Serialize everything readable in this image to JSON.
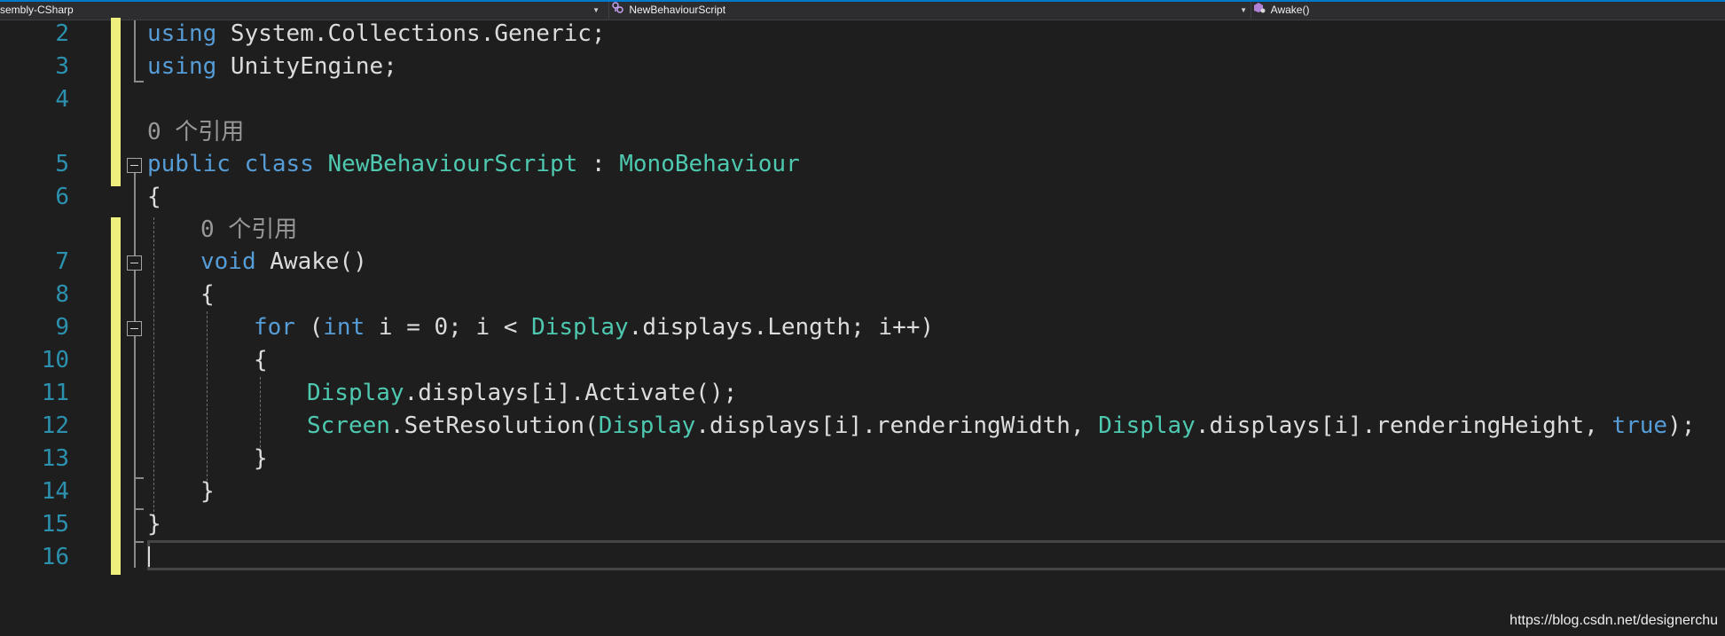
{
  "navbar": {
    "project": "sembly-CSharp",
    "type": "NewBehaviourScript",
    "member": "Awake()",
    "colors": {
      "background": "#2d2d30",
      "accent": "#007acc"
    }
  },
  "editor": {
    "line_numbers": [
      "2",
      "3",
      "4",
      "5",
      "6",
      "7",
      "8",
      "9",
      "10",
      "11",
      "12",
      "13",
      "14",
      "15",
      "16"
    ],
    "codelens_references": [
      "0 个引用",
      "0 个引用"
    ],
    "lines": {
      "l2": [
        "using",
        " System.Collections.Generic;"
      ],
      "l3": [
        "using",
        " UnityEngine;"
      ],
      "l5": [
        "public",
        " ",
        "class",
        " ",
        "NewBehaviourScript",
        " : ",
        "MonoBehaviour"
      ],
      "l6": [
        "{"
      ],
      "l7": [
        "void",
        " Awake()"
      ],
      "l8": [
        "{"
      ],
      "l9": [
        "for",
        " (",
        "int",
        " i = 0; i < ",
        "Display",
        ".displays.Length; i++)"
      ],
      "l10": [
        "{"
      ],
      "l11": [
        "Display",
        ".displays[i].Activate();"
      ],
      "l12": [
        "Screen",
        ".SetResolution(",
        "Display",
        ".displays[i].renderingWidth, ",
        "Display",
        ".displays[i].renderingHeight, ",
        "true",
        ");"
      ],
      "l13": [
        "}"
      ],
      "l14": [
        "}"
      ],
      "l15": [
        "}"
      ]
    },
    "colors": {
      "background": "#1e1e1e",
      "keyword": "#569cd6",
      "type": "#4ec9b0",
      "text": "#dcdcdc",
      "line_number": "#2b91af",
      "codelens": "#999999",
      "change_marker": "#efef7d"
    }
  },
  "watermark": "https://blog.csdn.net/designerchu"
}
